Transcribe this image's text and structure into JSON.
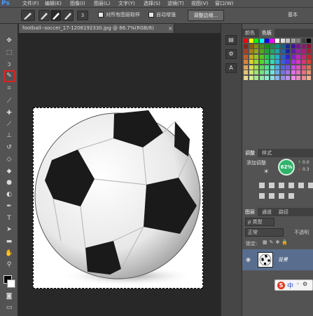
{
  "app": {
    "logo": "Ps"
  },
  "menu": [
    "文件(F)",
    "编辑(E)",
    "图像(I)",
    "图层(L)",
    "文字(Y)",
    "选择(S)",
    "滤镜(T)",
    "视图(V)",
    "窗口(W)"
  ],
  "options": {
    "brush_size": "3",
    "sample_all_label": "对所有图层取样",
    "auto_enhance_label": "自动增强",
    "refine_edge_label": "调整边缘..."
  },
  "document": {
    "tab_title": "football--soccer_17-1208192330.jpg @ 66.7%(RGB/8)"
  },
  "panels": {
    "right_top_label": "基本",
    "color_tabs": [
      "颜色",
      "色板"
    ],
    "adjust_tabs": [
      "调整",
      "样式"
    ],
    "add_adjustment_label": "添加调整",
    "percent_badge": "62%",
    "net_readouts": [
      "0.0",
      "0.3"
    ],
    "layers_tabs": [
      "图层",
      "通道",
      "路径"
    ],
    "kind_filter": "ρ 类型",
    "blend_mode": "正常",
    "opacity_label": "不透明",
    "lock_label": "锁定:",
    "layer_name": "背景"
  },
  "ime": {
    "label": "中"
  },
  "colors": {
    "accent_blue": "#3aa0ff",
    "selected_tool_border": "#e02020",
    "layer_selected": "#596e8e"
  }
}
